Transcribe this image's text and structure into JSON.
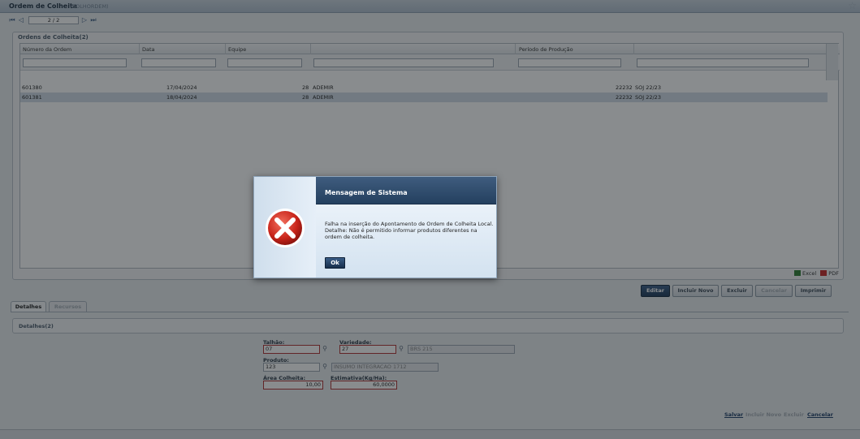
{
  "window": {
    "title": "Ordem de Colheita",
    "code": "(COLHORDEM)"
  },
  "pager": {
    "value": "2 / 2"
  },
  "list": {
    "caption": "Ordens de Colheita(2)",
    "columns": [
      "Número da Ordem",
      "Data",
      "Equipe",
      "",
      "Período de Produção",
      ""
    ],
    "rows": [
      {
        "numero": "601380",
        "data": "17/04/2024",
        "equipe": "28",
        "equipe_nome": "ADEMIR",
        "periodo": "22232",
        "periodo_nome": "SOJ 22/23",
        "selected": false
      },
      {
        "numero": "601381",
        "data": "18/04/2024",
        "equipe": "28",
        "equipe_nome": "ADEMIR",
        "periodo": "22232",
        "periodo_nome": "SOJ 22/23",
        "selected": true
      }
    ],
    "export_excel": "Excel",
    "export_pdf": "PDF"
  },
  "toolbar": {
    "editar": "Editar",
    "incluir_novo": "Incluir Novo",
    "excluir": "Excluir",
    "cancelar": "Cancelar",
    "imprimir": "Imprimir"
  },
  "tabs": {
    "detalhes": "Detalhes",
    "recursos": "Recursos"
  },
  "details": {
    "caption": "Detalhes(2)",
    "talhao_label": "Talhão:",
    "talhao_value": "07",
    "variedade_label": "Variedade:",
    "variedade_value": "27",
    "variedade_desc": "BRS 215",
    "produto_label": "Produto:",
    "produto_value": "123",
    "produto_desc": "INSUMO INTEGRACAO 1712",
    "area_label": "Área Colheita:",
    "area_value": "10,00",
    "estimativa_label": "Estimativa(Kg/Ha):",
    "estimativa_value": "60,0000"
  },
  "footer_links": {
    "salvar": "Salvar",
    "incluir_novo": "Incluir Novo",
    "excluir": "Excluir",
    "cancelar": "Cancelar"
  },
  "dialog": {
    "title": "Mensagem de Sistema",
    "message": "Falha na inserção do Apontamento de Ordem de Colheita Local. Detalhe: Não é permitido informar produtos diferentes na ordem de colheita.",
    "ok": "Ok",
    "icon": "error-icon"
  }
}
